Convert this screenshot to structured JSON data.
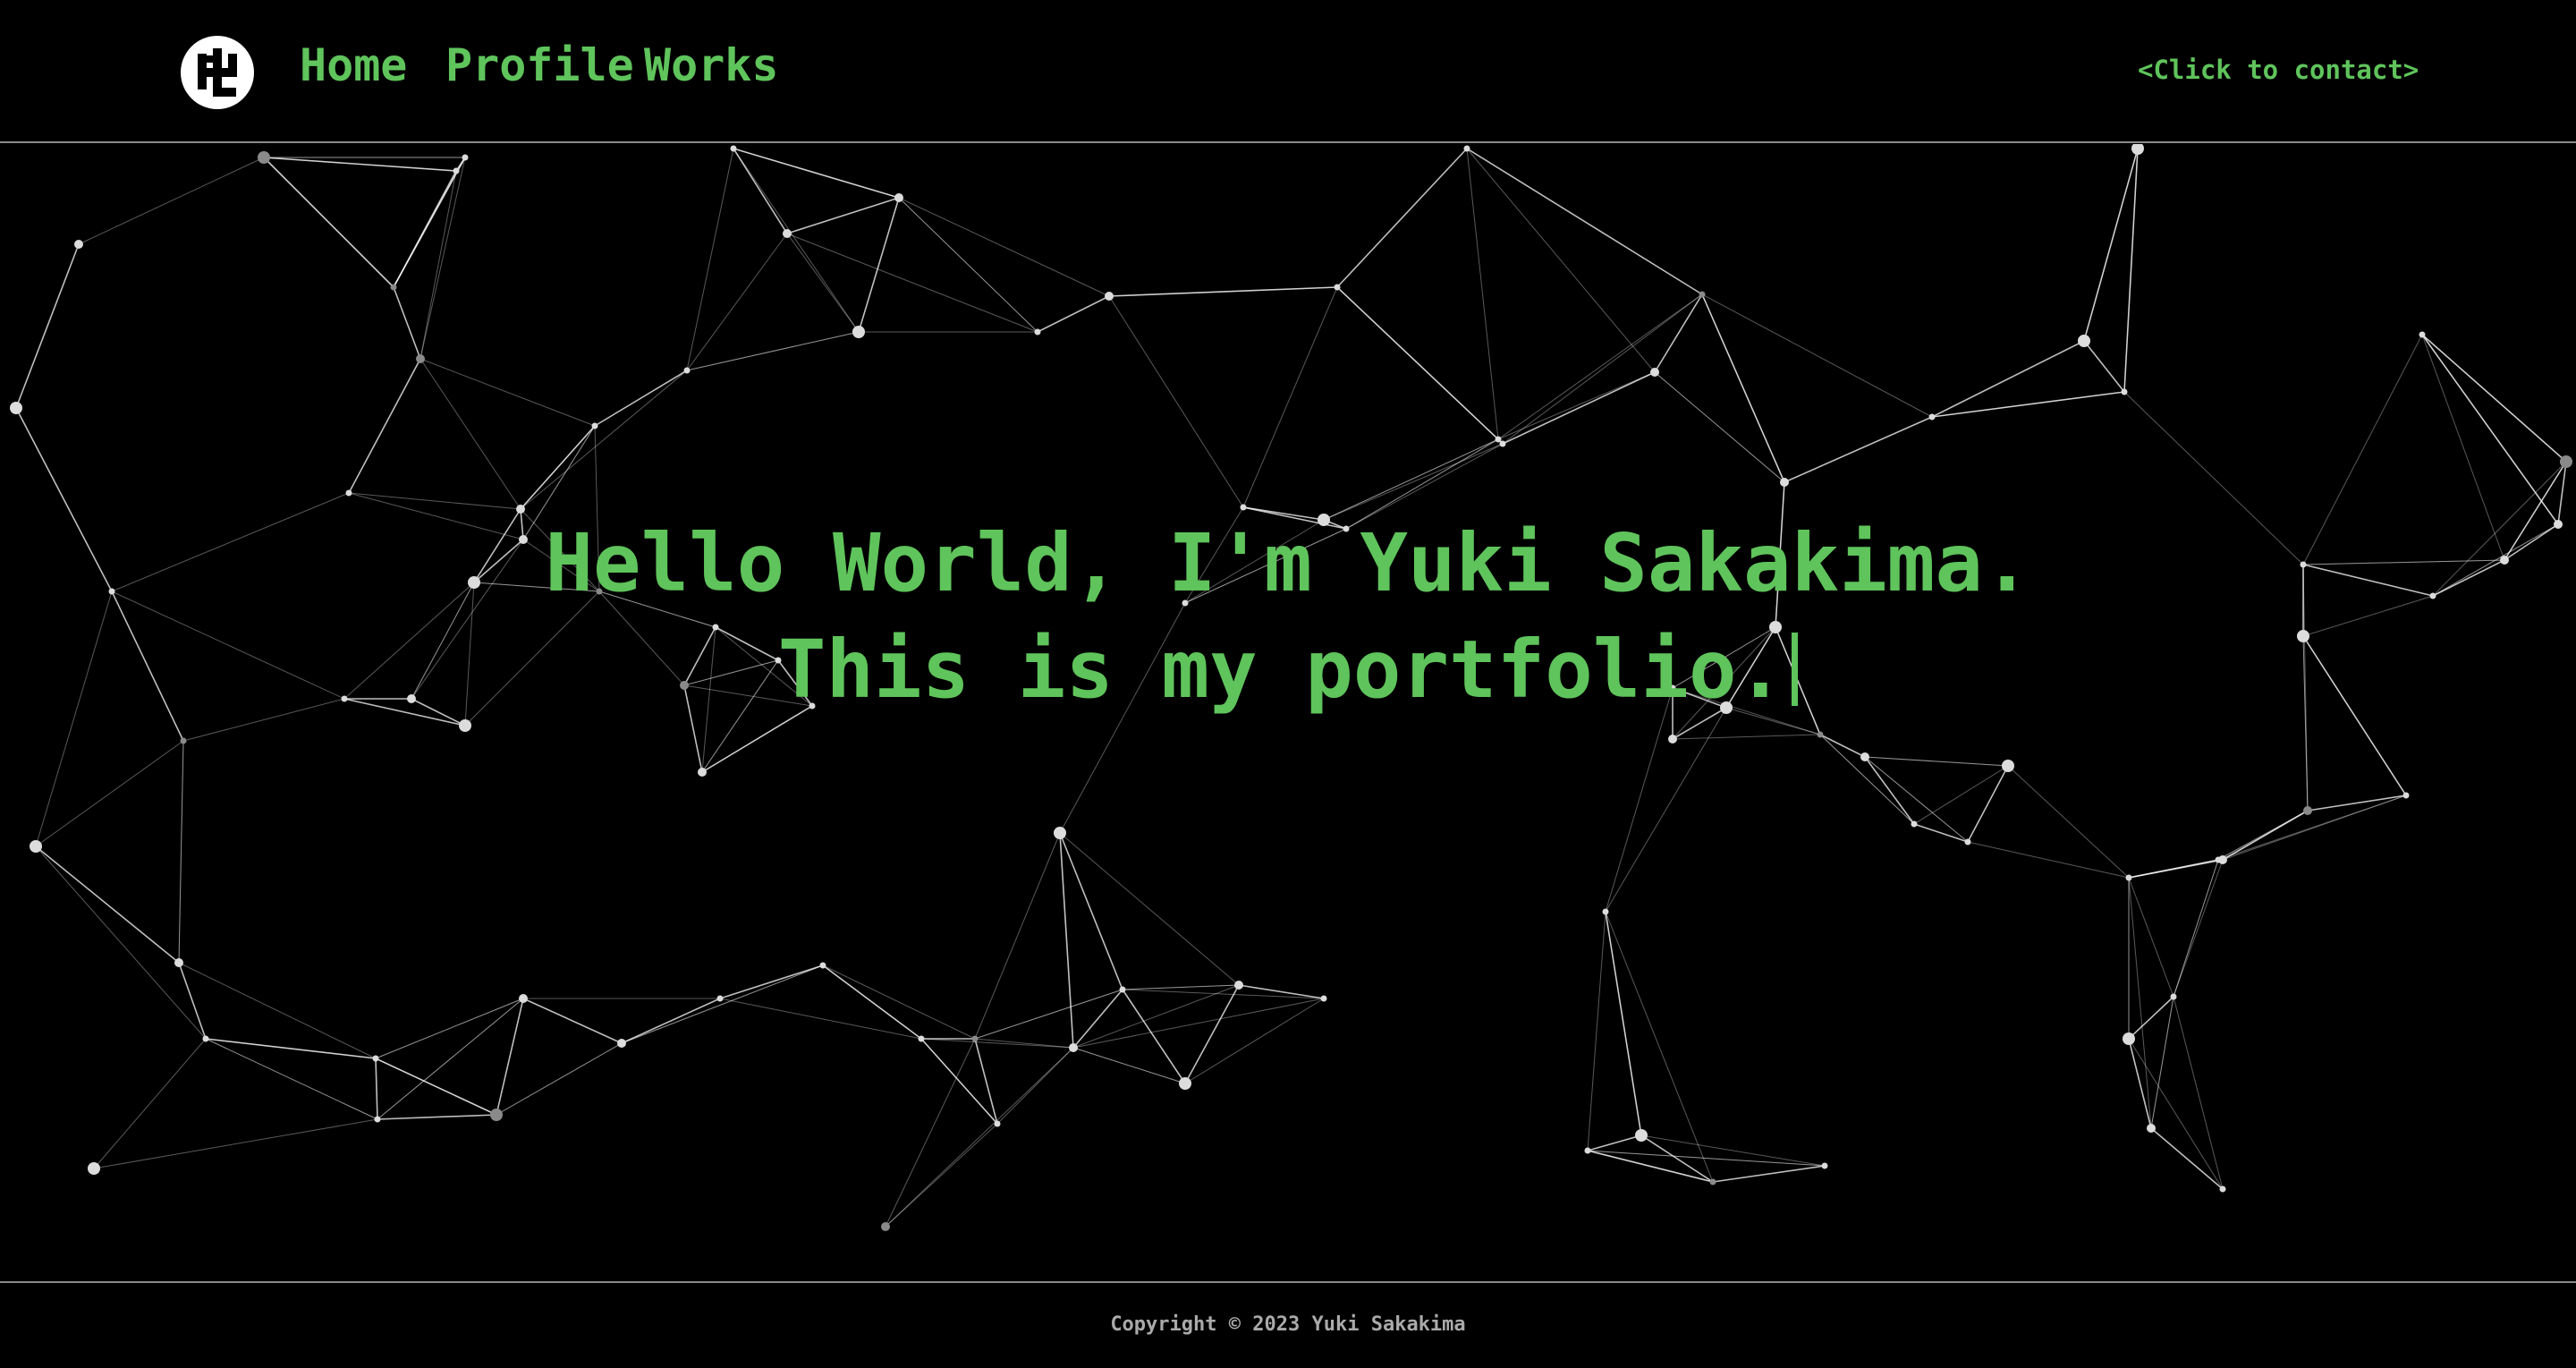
{
  "nav": {
    "home": "Home",
    "profile": "Profile",
    "works": "Works",
    "contact": "<Click to contact>"
  },
  "logo": {
    "icon": "yuki-logo-icon"
  },
  "hero": {
    "line1": "Hello World, I'm Yuki Sakakima.",
    "line2": "This is my portfolio."
  },
  "footer": {
    "copyright": "Copyright © 2023 Yuki Sakakima"
  },
  "colors": {
    "accent": "#5fc45b",
    "background": "#000000",
    "network_line": "#ffffff"
  }
}
